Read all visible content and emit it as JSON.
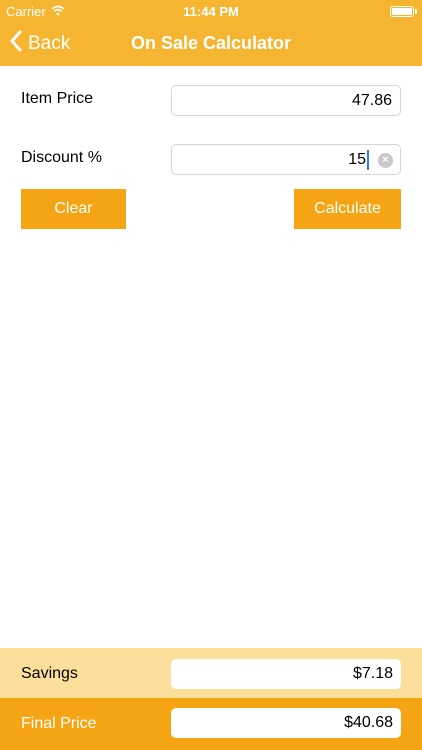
{
  "status_bar": {
    "carrier": "Carrier",
    "time": "11:44 PM"
  },
  "nav": {
    "back_label": "Back",
    "title": "On Sale Calculator"
  },
  "form": {
    "item_price_label": "Item Price",
    "item_price_value": "47.86",
    "discount_label": "Discount %",
    "discount_value": "15"
  },
  "buttons": {
    "clear_label": "Clear",
    "calculate_label": "Calculate"
  },
  "results": {
    "savings_label": "Savings",
    "savings_value": "$7.18",
    "final_price_label": "Final Price",
    "final_price_value": "$40.68"
  },
  "colors": {
    "nav_bar": "#f6b530",
    "button": "#f5a513",
    "savings_panel": "#fbdf9a",
    "final_panel": "#f5a513"
  },
  "icons": {
    "signal": "wifi-icon",
    "battery": "battery-icon",
    "back": "chevron-left-icon",
    "clear_field": "clear-circle-icon"
  }
}
